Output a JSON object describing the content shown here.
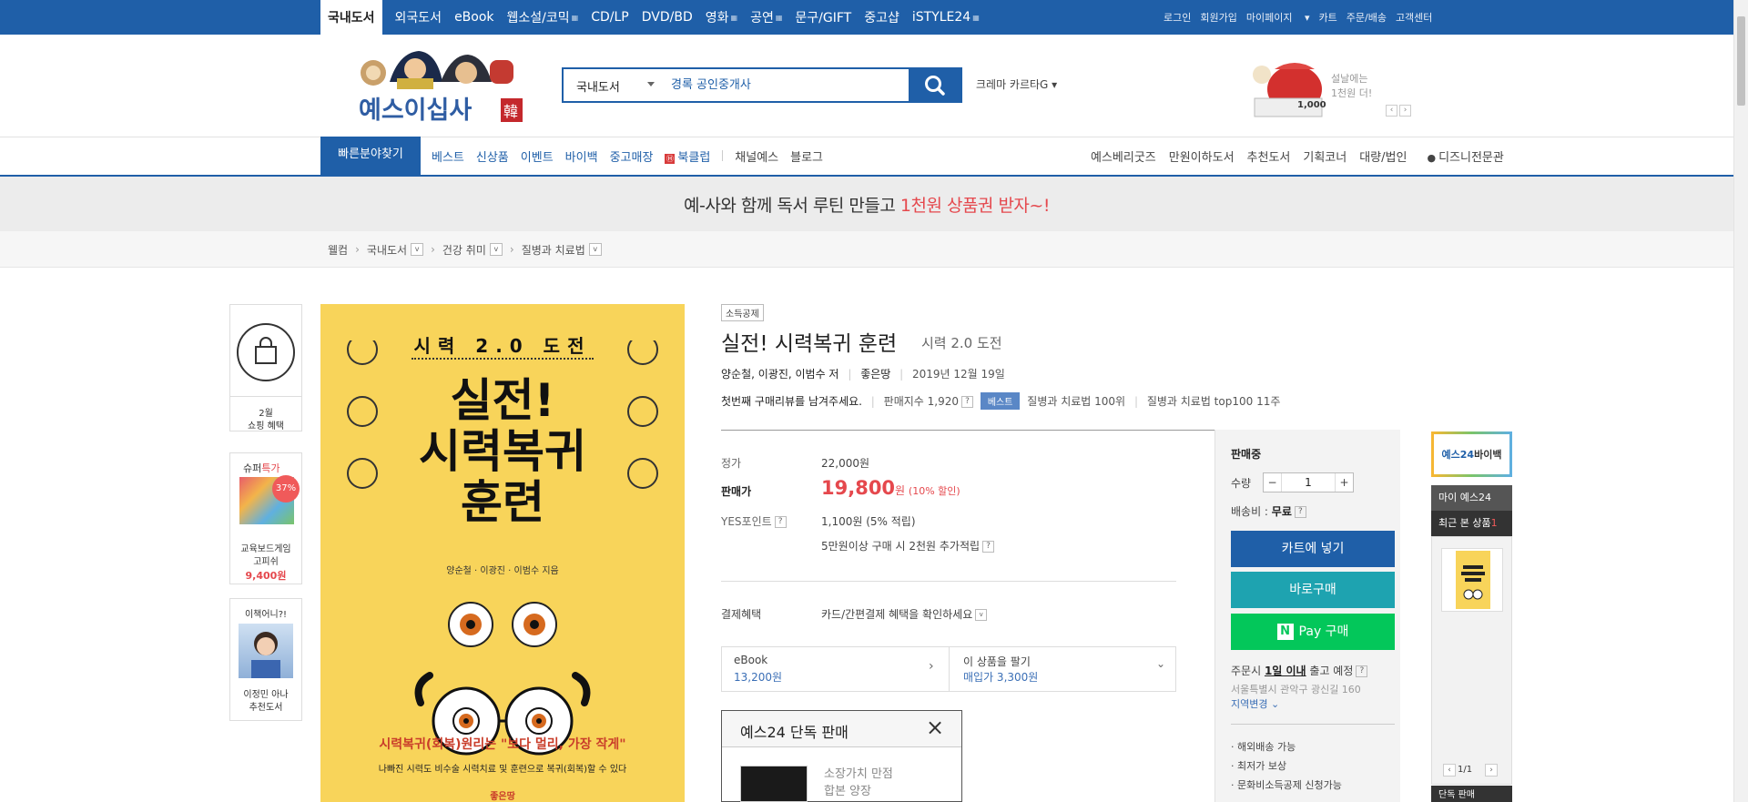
{
  "topnav": {
    "items": [
      "국내도서",
      "외국도서",
      "eBook",
      "웹소설/코믹",
      "CD/LP",
      "DVD/BD",
      "영화",
      "공연",
      "문구/GIFT",
      "중고샵",
      "iSTYLE24"
    ],
    "util": [
      "로그인",
      "회원가입",
      "마이페이지",
      "카트",
      "주문/배송",
      "고객센터"
    ]
  },
  "header": {
    "logo_text": "예스이십사",
    "logo_badge": "韓",
    "search_category": "국내도서",
    "search_query": "경록 공인중개사",
    "crema": "크레마 카르타G",
    "promo_line1": "설날에는",
    "promo_line2": "1천원 더!",
    "promo_amount": "1,000"
  },
  "gnb": {
    "quickfind": "빠른분야찾기",
    "left": [
      "베스트",
      "신상품",
      "이벤트",
      "바이백",
      "중고매장",
      "북클럽",
      "채널예스",
      "블로그"
    ],
    "right": [
      "예스베리굿즈",
      "만원이하도서",
      "추천도서",
      "기획코너",
      "대량/법인",
      "디즈니전문관"
    ]
  },
  "banner": {
    "pre": "예-사와 함께 독서 루틴 만들고 ",
    "highlight": "1천원 상품권 받자~!"
  },
  "breadcrumb": [
    "웰컴",
    "국내도서",
    "건강 취미",
    "질병과 치료법"
  ],
  "leftrail": {
    "shopping_label1": "2월",
    "shopping_label2": "쇼핑 혜택",
    "super_pre": "슈퍼",
    "super_hl": "특가",
    "super_badge": "37%",
    "super_name1": "교육보드게임",
    "super_name2": "고피쉬",
    "super_price": "9,400원",
    "ichaek_title": "이책어니?!",
    "ichaek_name1": "이정민 아나",
    "ichaek_name2": "추천도서"
  },
  "cover": {
    "top": "시력 2.0 도전",
    "t1": "실전!",
    "t2": "시력복귀",
    "t3": "훈련",
    "authors": "양순철 · 이광진 · 이범수 지음",
    "quote": "시력복귀(회복)원리는 \"보다 멀리, 가장 작게\"",
    "bottom": "나빠진 시력도 비수술 시력치료 및 훈련으로 복귀(회복)할 수 있다",
    "publisher": "좋은땅"
  },
  "product": {
    "tag": "소득공제",
    "title": "실전! 시력복귀 훈련",
    "subtitle": "시력 2.0 도전",
    "authors": "양순철, 이광진, 이범수 저",
    "publisher": "좋은땅",
    "date": "2019년 12월 19일",
    "review": "첫번째 구매리뷰를 남겨주세요.",
    "sales_index": "판매지수 1,920",
    "best_badge": "베스트",
    "rank1": "질병과 치료법 100위",
    "rank2": "질병과 치료법 top100 11주",
    "list_price_label": "정가",
    "list_price": "22,000원",
    "sale_price_label": "판매가",
    "sale_price": "19,800",
    "won": "원",
    "discount": "(10% 할인)",
    "points_label": "YES포인트",
    "points": "1,100원 (5% 적립)",
    "extra_points": "5만원이상 구매 시 2천원 추가적립",
    "payment_label": "결제혜택",
    "payment": "카드/간편결제 혜택을 확인하세요",
    "ebook_label": "eBook",
    "ebook_price": "13,200원",
    "sell_label": "이 상품을 팔기",
    "sell_price": "매입가 3,300원",
    "exclusive_title": "예스24 단독 판매",
    "exclusive_l1": "소장가치 만점",
    "exclusive_l2": "합본 양장"
  },
  "buy": {
    "status": "판매중",
    "qty_label": "수량",
    "qty": "1",
    "shipping": "배송비 : ",
    "shipping_val": "무료",
    "cart_btn": "카트에 넣기",
    "buy_btn": "바로구매",
    "npay_btn": "Pay 구매",
    "order_pre": "주문시 ",
    "order_bold": "1일 이내",
    "order_post": " 출고 예정",
    "address": "서울특별시 관악구 광신길 160",
    "region": "지역변경",
    "benefits": [
      "해외배송 가능",
      "최저가 보상",
      "문화비소득공제 신청가능"
    ]
  },
  "rightrail": {
    "buyback_pre": "예스24",
    "buyback_post": "바이백",
    "my": "마이 예스24",
    "recent": "최근 본 상품",
    "recent_count": "1",
    "page": "1/1",
    "bottom": "단독 판매"
  }
}
